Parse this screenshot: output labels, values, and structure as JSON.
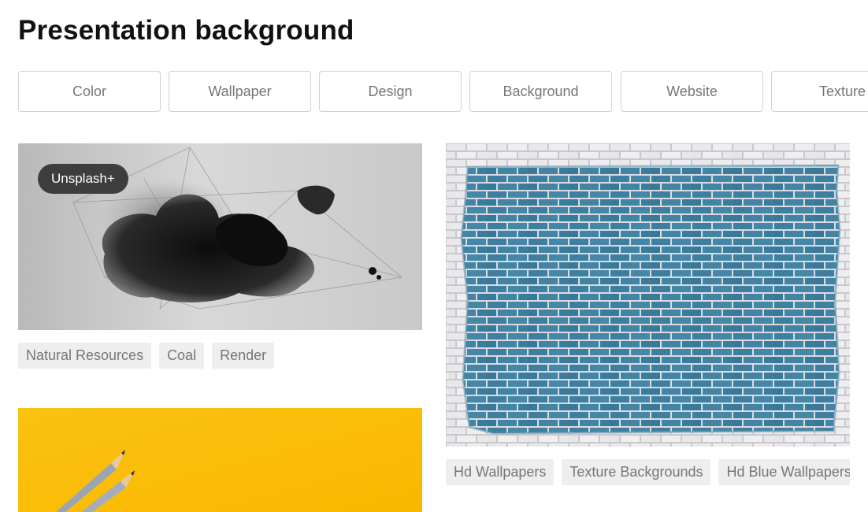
{
  "page": {
    "title": "Presentation background"
  },
  "related_searches": [
    {
      "label": "Color"
    },
    {
      "label": "Wallpaper"
    },
    {
      "label": "Design"
    },
    {
      "label": "Background"
    },
    {
      "label": "Website"
    },
    {
      "label": "Texture"
    }
  ],
  "photos": [
    {
      "subject": "black ink cloud with geometric lines on grey",
      "badge": "Unsplash+",
      "tags": [
        {
          "label": "Natural Resources"
        },
        {
          "label": "Coal"
        },
        {
          "label": "Render"
        }
      ]
    },
    {
      "subject": "blue painted brick wall",
      "tags": [
        {
          "label": "Hd Wallpapers"
        },
        {
          "label": "Texture Backgrounds"
        },
        {
          "label": "Hd Blue Wallpapers"
        }
      ]
    },
    {
      "subject": "pencils on yellow background"
    }
  ],
  "colors": {
    "chip_border": "#d1d1d1",
    "chip_text": "#767676",
    "tag_bg": "#eeeeee",
    "tag_text": "#767676",
    "badge_bg": "#323232",
    "yellow": "#fbbd08",
    "brick_blue": "#3e7fa0"
  }
}
